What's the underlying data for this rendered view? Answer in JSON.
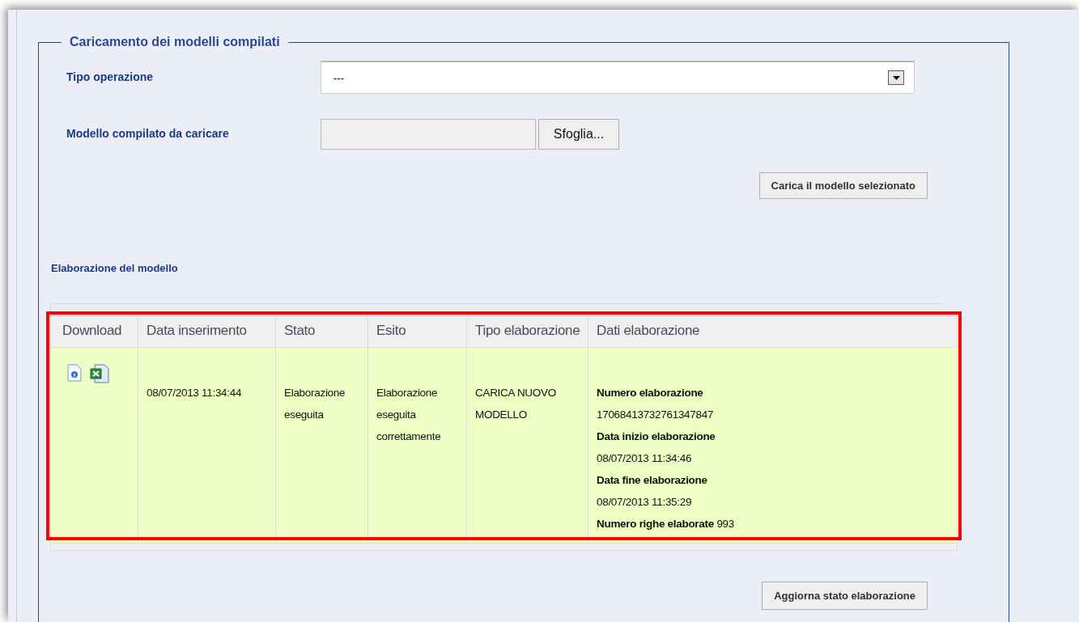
{
  "fieldset": {
    "legend": "Caricamento dei modelli compilati"
  },
  "fields": [
    {
      "kind": "select",
      "label": "Tipo operazione",
      "value": "---"
    },
    {
      "kind": "file",
      "label": "Modello compilato da caricare",
      "button": "Sfoglia..."
    }
  ],
  "upload_button": "Carica il modello selezionato",
  "section_title": "Elaborazione del modello",
  "table": {
    "highlighted": true,
    "columns": [
      "Download",
      "Data inserimento",
      "Stato",
      "Esito",
      "Tipo elaborazione",
      "Dati elaborazione"
    ],
    "rows": [
      {
        "inserted": "08/07/2013 11:34:44",
        "state": "Elaborazione eseguita",
        "outcome": "Elaborazione eseguita correttamente",
        "type": "CARICA NUOVO MODELLO",
        "details": [
          {
            "kind": "label",
            "text": "Numero elaborazione"
          },
          {
            "kind": "value",
            "text": "17068413732761347847"
          },
          {
            "kind": "label",
            "text": "Data inizio elaborazione"
          },
          {
            "kind": "value",
            "text": "08/07/2013 11:34:46"
          },
          {
            "kind": "label",
            "text": "Data fine elaborazione"
          },
          {
            "kind": "value",
            "text": "08/07/2013 11:35:29"
          },
          {
            "kind": "mixed",
            "text": "**Numero righe elaborate** 993"
          }
        ]
      }
    ]
  },
  "refresh_button": "Aggiorna stato elaborazione"
}
